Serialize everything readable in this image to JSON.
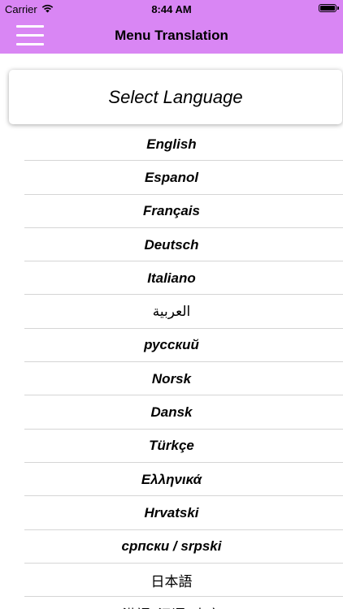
{
  "status_bar": {
    "carrier": "Carrier",
    "time": "8:44 AM",
    "icons": [
      "wifi-icon",
      "battery-icon"
    ]
  },
  "nav_bar": {
    "title": "Menu Translation",
    "menu_icon": "hamburger-menu-icon",
    "background_color": "#d986f4"
  },
  "header": {
    "title": "Select Language"
  },
  "languages": [
    {
      "label": "English",
      "style": "bold-italic"
    },
    {
      "label": "Espanol",
      "style": "bold-italic"
    },
    {
      "label": "Français",
      "style": "bold-italic"
    },
    {
      "label": "Deutsch",
      "style": "bold-italic"
    },
    {
      "label": "Italiano",
      "style": "bold-italic"
    },
    {
      "label": "العربية",
      "style": "plain"
    },
    {
      "label": "русский",
      "style": "bold-italic"
    },
    {
      "label": "Norsk",
      "style": "bold-italic"
    },
    {
      "label": "Dansk",
      "style": "bold-italic"
    },
    {
      "label": "Türkçe",
      "style": "bold-italic"
    },
    {
      "label": "Ελληνικά",
      "style": "bold-italic"
    },
    {
      "label": "Hrvatski",
      "style": "bold-italic"
    },
    {
      "label": "српски / srpski",
      "style": "bold-italic"
    },
    {
      "label": "日本語",
      "style": "plain"
    },
    {
      "label": "漢語; 汉语; 中文",
      "style": "plain"
    }
  ]
}
